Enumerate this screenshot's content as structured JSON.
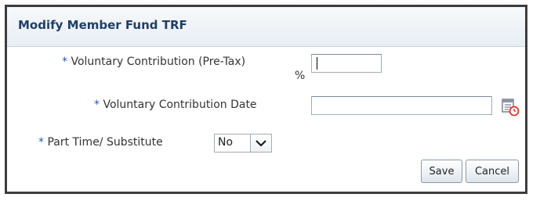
{
  "dialog": {
    "title": "Modify Member Fund TRF"
  },
  "form": {
    "required_marker": "*",
    "contribution_pretax": {
      "label": "Voluntary Contribution (Pre-Tax)",
      "label_unit": "%",
      "value": ""
    },
    "contribution_date": {
      "label": "Voluntary Contribution Date",
      "value": "",
      "icon": "calendar-clock-icon"
    },
    "part_time": {
      "label": "Part Time/ Substitute",
      "selected": "No",
      "icon": "chevron-down-icon"
    }
  },
  "actions": {
    "save_label": "Save",
    "cancel_label": "Cancel"
  },
  "colors": {
    "title": "#1f3f66",
    "required_marker": "#2a5aa8",
    "border": "#3d3d3d"
  }
}
